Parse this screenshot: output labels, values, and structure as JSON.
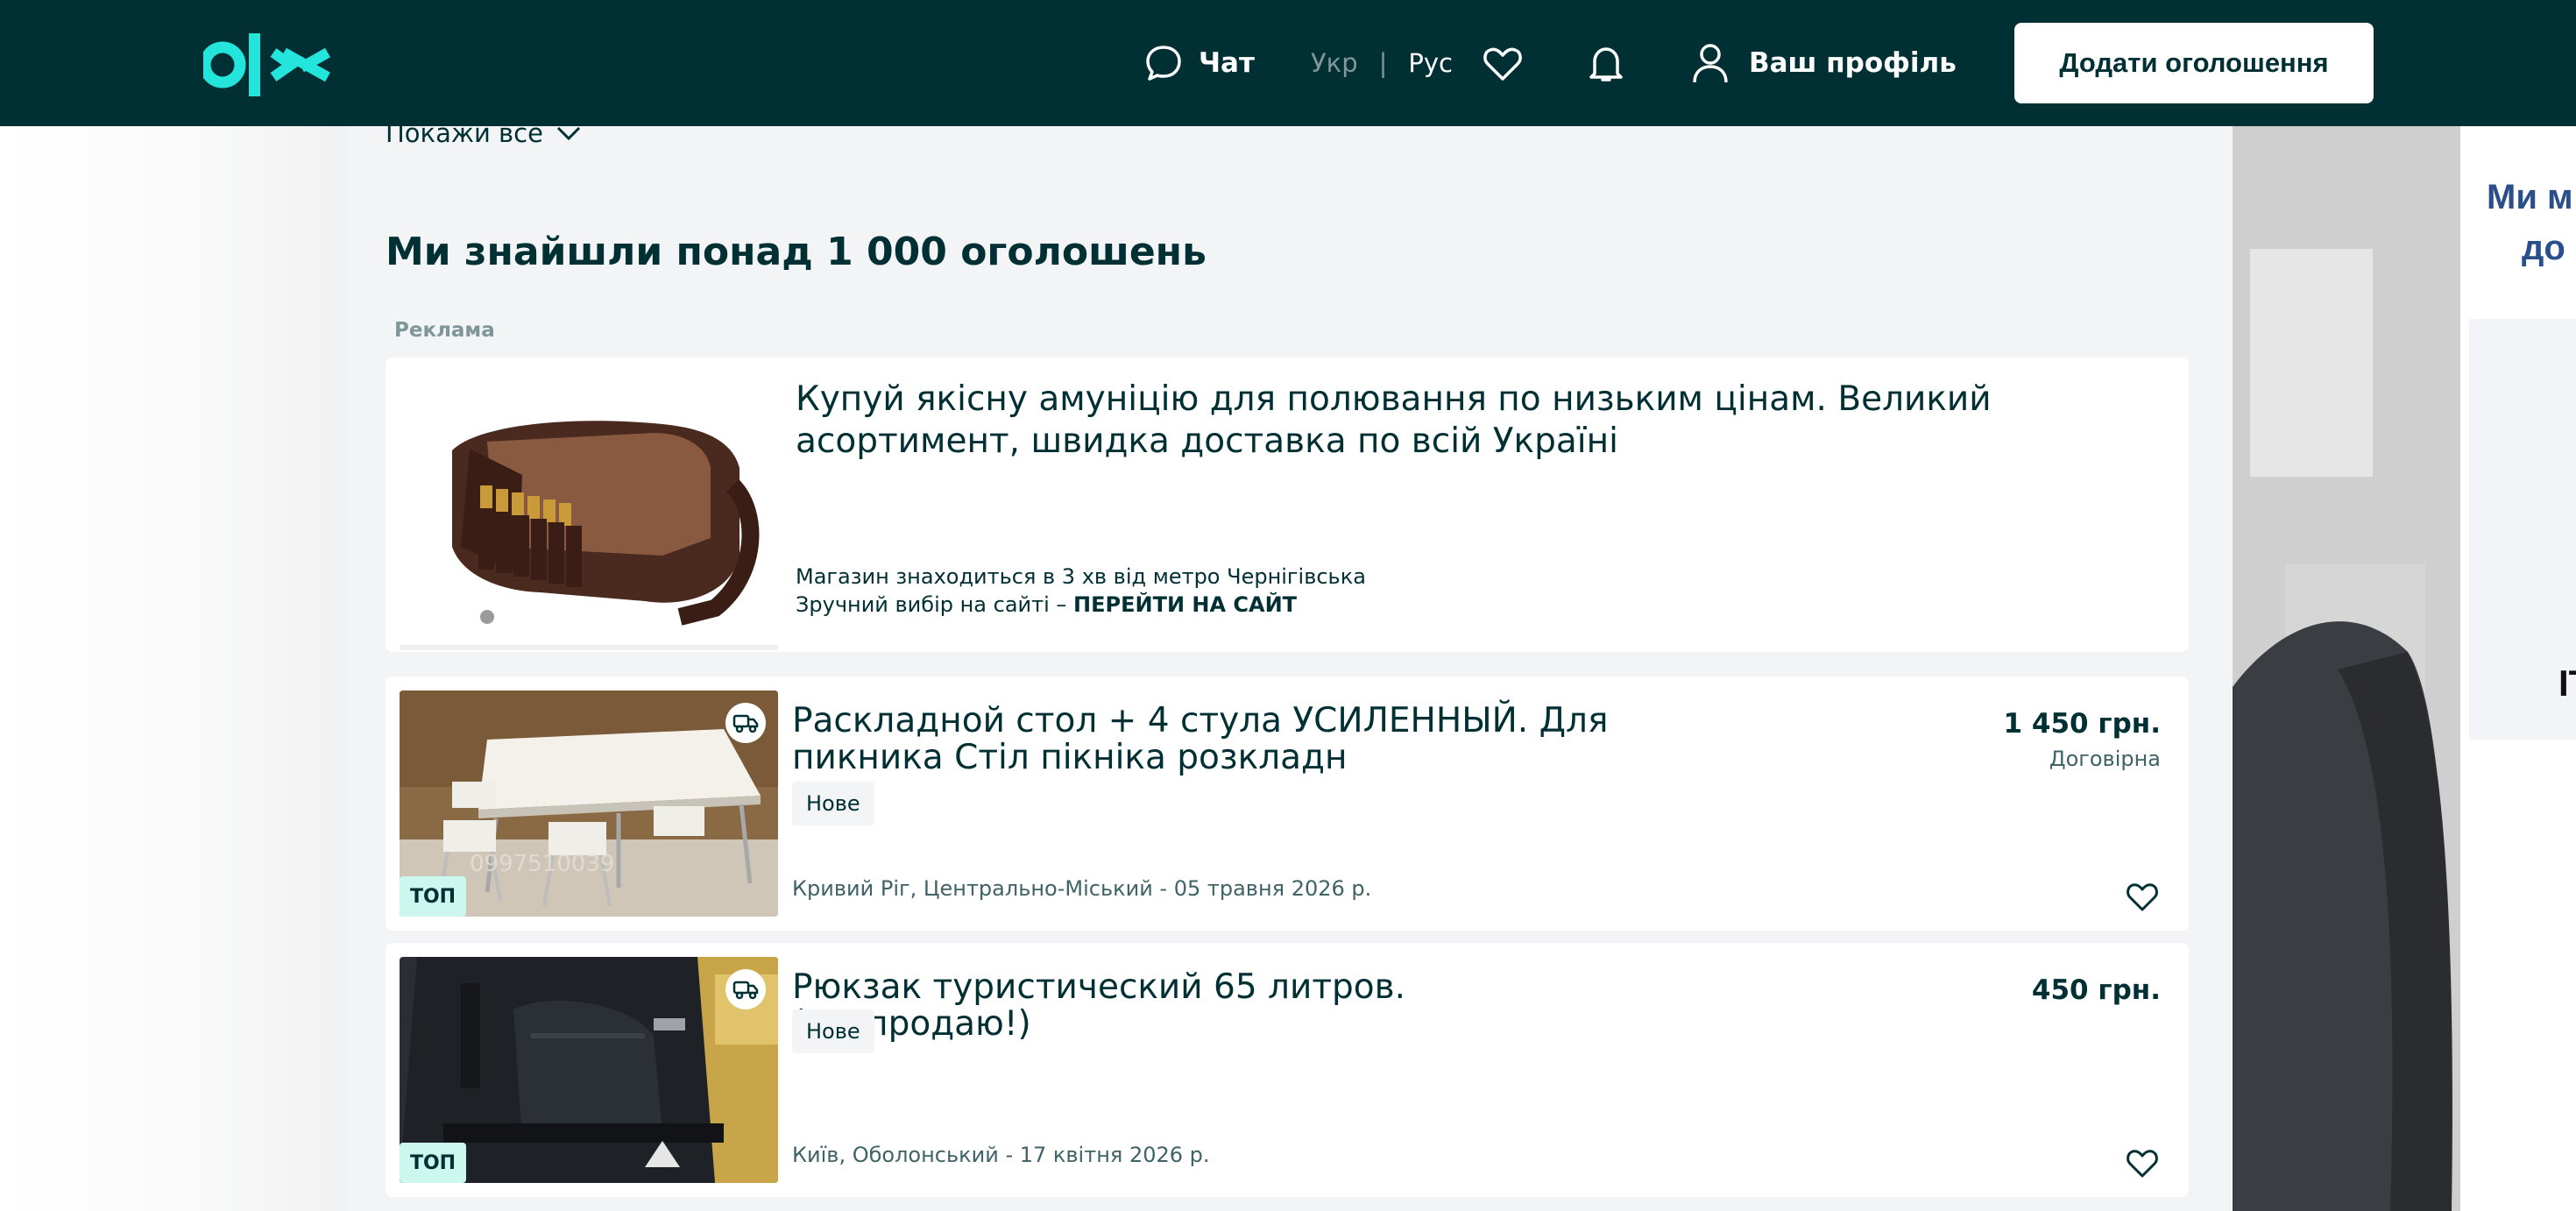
{
  "header": {
    "chat_label": "Чат",
    "lang_ukr": "Укр",
    "lang_sep": "|",
    "lang_rus": "Рус",
    "profile_label": "Ваш профіль",
    "post_button": "Додати оголошення",
    "colors": {
      "header_bg": "#002f34",
      "brand_teal": "#23e5db"
    }
  },
  "filters": {
    "show_all": "Покажи все"
  },
  "results": {
    "title": "Ми знайшли понад 1 000 оголошень"
  },
  "ad": {
    "label": "Реклама",
    "title": "Купуй якісну амуніцію для полювання по низьким цінам. Великий асортимент, швидка доставка по всій Україні",
    "line1": "Магазин знаходиться в 3 хв від метро Чернігівська",
    "line2_prefix": "Зручний вибір на сайті – ",
    "line2_link": "ПЕРЕЙТИ НА САЙТ"
  },
  "listings": [
    {
      "title": "Раскладной стол + 4 стула УСИЛЕННЫЙ. Для пикника Стіл пікніка розкладн",
      "condition": "Нове",
      "location_date": "Кривий Ріг, Центрально-Міський - 05 травня 2026 р.",
      "price": "1 450 грн.",
      "negotiable": "Договірна",
      "badge": "ТОП",
      "image_watermark": "0997510039",
      "icons": [
        "delivery-icon",
        "heart-icon"
      ]
    },
    {
      "title": "Рюкзак туристический 65 литров. (Распродаю!)",
      "condition": "Нове",
      "location_date": "Київ, Оболонський - 17 квітня 2026 р.",
      "price": "450 грн.",
      "badge": "ТОП",
      "icons": [
        "delivery-icon",
        "heart-icon"
      ]
    }
  ],
  "banner": {
    "line1": "Ми м",
    "line2": "до",
    "side_text": "IT"
  }
}
